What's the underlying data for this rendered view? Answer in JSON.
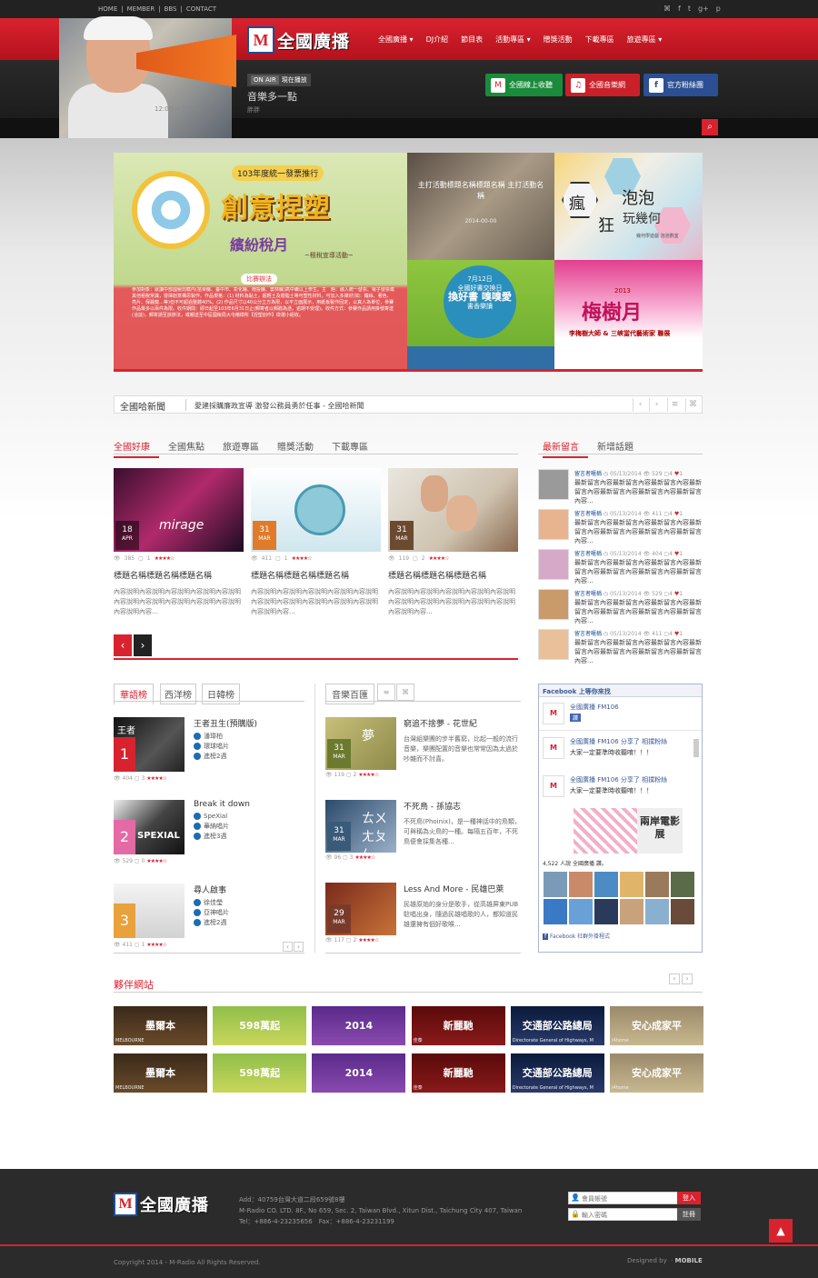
{
  "topbar": {
    "links": [
      "HOME",
      "MEMBER",
      "BBS",
      "CONTACT"
    ],
    "social_icons": [
      "rss-icon",
      "facebook-icon",
      "twitter-icon",
      "googleplus-icon",
      "pinterest-icon"
    ],
    "social_glyphs": [
      "⌘",
      "f",
      "t",
      "g+",
      "p"
    ]
  },
  "brand": {
    "logo_badge": "M",
    "logo_sub": "FM106",
    "name": "全國廣播",
    "accent": "#d8232f",
    "blue": "#1b4d9c"
  },
  "nav": [
    "全國廣播 ▾",
    "DJ介紹",
    "節目表",
    "活動專區 ▾",
    "贈獎活動",
    "下載專區",
    "旅遊專區 ▾"
  ],
  "onair": {
    "badge": "ON AIR",
    "label": "現在播放",
    "show": "音樂多一點",
    "dj": "胖胖",
    "time": "12:00 ~ 15:00"
  },
  "header_buttons": [
    "全國線上收聽",
    "全國音樂網",
    "官方粉絲團"
  ],
  "banner": {
    "main": {
      "tag": "103年度統一發票推行",
      "title": "創意捏塑",
      "subtitle": "繽紛稅月",
      "sub2": "~租稅宣導活動~",
      "pill": "比賽辦法",
      "body": "參加對象：就讀中部國稅局轄內(苗栗縣、臺中市、彰化縣、南投縣、雲林縣)高中職以上學生。主　題：融入統一發票、電子發票或其他租稅常識，發揮創意構思製作。作品規格：(1) 材料為黏土，超輕土及樹脂土等可塑性材料，可加入多媒材(如：鐵絲、著色、亮片、保麗龍…等)但不可超過整體40%。(2) 作品尺寸以40公分立方為限，以平立面展示，用紙板製作固定，以真人為單位，參賽作品最多以兩件為限。收件期間：即日起至103年6月31日止(郵寄者以郵戳為憑，逾期不受理)。收件方式：參賽作品請用掛號寄送(洽談)，郵寄請至該辦法，或親送至中區國稅局大屯稽徵所【捏塑創作】徵選小組收。"
    },
    "top_mid": {
      "caption": "主打活動標題名稱標題名稱 主打活動名稱",
      "date": "2014-00-00"
    },
    "top_right": {
      "chars": [
        "瘋",
        "狂",
        "泡泡"
      ],
      "title": "玩幾何",
      "sub": "幾何學遊戲 泡泡數室"
    },
    "bottom_mid": {
      "date": "7月12日",
      "line1": "全國好書交換日",
      "line2": "換好書 嗅嗅愛",
      "line3": "書香樂讀"
    },
    "bottom_right": {
      "year": "2013",
      "title": "梅樹月",
      "sub": "李梅樹大師 & 三峽當代藝術家 聯展"
    }
  },
  "ticker": {
    "label": "全國哈新聞",
    "text": "愛建採購廉政宣導 激發公務員勇於任事 - 全國哈新聞"
  },
  "news_tabs": [
    "全國好康",
    "全國焦點",
    "旅遊專區",
    "贈獎活動",
    "下載專區"
  ],
  "cards": [
    {
      "day": "18",
      "mon": "APR",
      "views": "385",
      "comments": "1",
      "stars": "★★★★☆",
      "title": "標題名稱標題名稱標題名稱",
      "desc": "內容說明內容說明內容說明內容說明內容說明內容說明內容說明內容說明內容說明內容說明內容說明內容..."
    },
    {
      "day": "31",
      "mon": "MAR",
      "views": "411",
      "comments": "1",
      "stars": "★★★★☆",
      "title": "標題名稱標題名稱標題名稱",
      "desc": "內容說明內容說明內容說明內容說明內容說明內容說明內容說明內容說明內容說明內容說明內容說明內容..."
    },
    {
      "day": "31",
      "mon": "MAR",
      "views": "119",
      "comments": "2",
      "stars": "★★★★☆",
      "title": "標題名稱標題名稱標題名稱",
      "desc": "內容說明內容說明內容說明內容說明內容說明內容說明內容說明內容說明內容說明內容說明內容說明內容..."
    }
  ],
  "card_overlay": "mirage",
  "comment_tabs": [
    "最新留言",
    "新增話題"
  ],
  "comments": [
    {
      "name": "留言者暱稱",
      "date": "05/13/2014",
      "views": "529",
      "c": "4",
      "l": "1",
      "text": "最新留言內容最新留言內容最新留言內容最新留言內容最新留言內容最新留言內容最新留言內容..."
    },
    {
      "name": "留言者暱稱",
      "date": "05/13/2014",
      "views": "411",
      "c": "4",
      "l": "1",
      "text": "最新留言內容最新留言內容最新留言內容最新留言內容最新留言內容最新留言內容最新留言內容..."
    },
    {
      "name": "留言者暱稱",
      "date": "05/13/2014",
      "views": "404",
      "c": "4",
      "l": "1",
      "text": "最新留言內容最新留言內容最新留言內容最新留言內容最新留言內容最新留言內容最新留言內容..."
    },
    {
      "name": "留言者暱稱",
      "date": "05/13/2014",
      "views": "529",
      "c": "4",
      "l": "1",
      "text": "最新留言內容最新留言內容最新留言內容最新留言內容最新留言內容最新留言內容最新留言內容..."
    },
    {
      "name": "留言者暱稱",
      "date": "05/13/2014",
      "views": "411",
      "c": "4",
      "l": "1",
      "text": "最新留言內容最新留言內容最新留言內容最新留言內容最新留言內容最新留言內容最新留言內容..."
    }
  ],
  "chart_tabs": [
    "華語榜",
    "西洋榜",
    "日韓榜"
  ],
  "charts": [
    {
      "rank": "1",
      "title": "王者丑生(預購版)",
      "artist": "潘瑋柏",
      "label": "環球唱片",
      "weeks": "進榜2週",
      "views": "404",
      "comments": "3",
      "stars": "★★★★☆",
      "img_text": "王者"
    },
    {
      "rank": "2",
      "title": "Break it down",
      "artist": "SpeXial",
      "label": "華納唱片",
      "weeks": "進榜3週",
      "views": "529",
      "comments": "0",
      "stars": "★★★★☆",
      "img_text": "SPEXIAL"
    },
    {
      "rank": "3",
      "title": "尋人啟事",
      "artist": "徐佳瑩",
      "label": "亞神唱片",
      "weeks": "進榜2週",
      "views": "411",
      "comments": "1",
      "stars": "★★★★☆",
      "img_text": ""
    }
  ],
  "music_tab": "音樂百匯",
  "music": [
    {
      "day": "31",
      "mon": "MAR",
      "title": "窮追不捨夢 - 花世紀",
      "desc": "台灣組樂團的步半舊窮，比起一般的流行音樂，樂團配置的音樂也常常因為太過於吵雜而不討喜。",
      "views": "119",
      "comments": "2",
      "stars": "★★★★☆",
      "img_text": "夢"
    },
    {
      "day": "31",
      "mon": "MAR",
      "title": "不死鳥 - 孫協志",
      "desc": "不死鳥(Phoinix)，是一種神話中的鳥類，可與稱為火鳥的一種。每隔五百年，不死鳥便會採集各種...",
      "views": "96",
      "comments": "3",
      "stars": "★★★★☆",
      "img_text": "ㄊㄨㄤㄆㄣ"
    },
    {
      "day": "29",
      "mon": "MAR",
      "title": "Less And More - 民雄巴萊",
      "desc": "民雄原始的身分是歌手，從高雄屏東PUB駐唱出身，隨過民雄唱歌的人，都知道民雄還擁有個好歌喉...",
      "views": "117",
      "comments": "2",
      "stars": "★★★★☆",
      "img_text": ""
    }
  ],
  "facebook": {
    "header": "Facebook 上等你來找",
    "page_name": "全國廣播 FM106",
    "like": "讚",
    "post_name": "全國廣播 FM106 分享了 相撲粉絲",
    "post_text": "大家一定要準時收聽唷！！！",
    "shared_title": "兩岸電影展",
    "count_line": "4,522 人說 全國廣播 讚。",
    "plugin": "Facebook 社群外掛程式"
  },
  "partners_title": "夥伴網站",
  "partners": [
    "墨爾本",
    "598萬起",
    "2014",
    "新麗馳",
    "交通部公路總局",
    "安心成家平"
  ],
  "partners_sub": [
    "MELBOURNE",
    "",
    "",
    "佳泰",
    "Directorate General of Highways, M",
    "i4home"
  ],
  "footer": {
    "address": "Add：40759台灣大道二段659號8樓",
    "address_en": "M-Radio CO. LTD. 8F., No 659, Sec. 2, Taiwan Blvd., Xitun Dist., Taichung City 407, Taiwan",
    "tel": "Tel：+886-4-23235656　Fax：+886-4-23231199",
    "copyright": "Copyright 2014 - M-Radio All Rights Reserved.",
    "designed": "Designed by",
    "designer": "MOBILE",
    "user_placeholder": "會員帳號",
    "pass_placeholder": "輸入密碼",
    "login": "登入",
    "register": "註冊"
  }
}
